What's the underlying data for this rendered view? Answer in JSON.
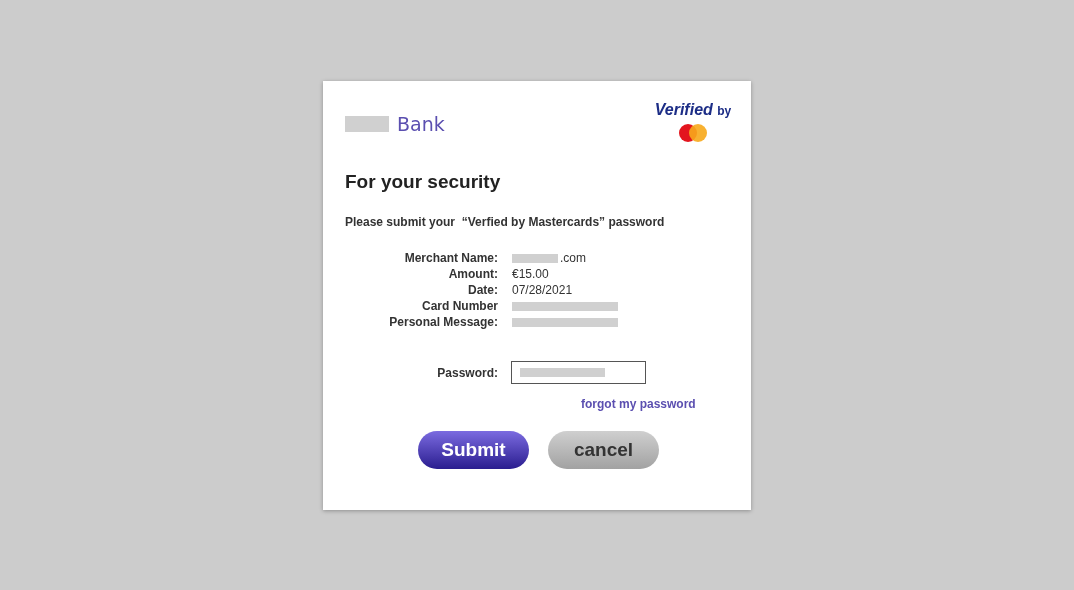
{
  "bank": {
    "redacted": true,
    "name": "Bank"
  },
  "badge": {
    "title": "Verified",
    "suffix": "by"
  },
  "heading": "For your security",
  "instruction": "Please submit your  “Verfied by Mastercards” password",
  "details": [
    {
      "label": "Merchant Name:",
      "value": ".com",
      "redacted": true
    },
    {
      "label": "Amount:",
      "value": "€15.00",
      "redacted": false
    },
    {
      "label": "Date:",
      "value": "07/28/2021",
      "redacted": false
    },
    {
      "label": "Card Number",
      "redacted": true
    },
    {
      "label": "Personal Message:",
      "redacted": true
    }
  ],
  "password": {
    "label": "Password:",
    "masked": true
  },
  "forgot_link": "forgot my password",
  "buttons": [
    {
      "label": "Submit",
      "kind": "primary"
    },
    {
      "label": "cancel",
      "kind": "secondary"
    }
  ]
}
